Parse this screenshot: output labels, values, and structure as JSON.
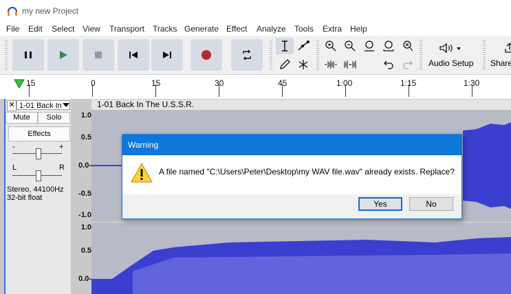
{
  "window": {
    "title": "my new Project"
  },
  "menu": [
    "File",
    "Edit",
    "Select",
    "View",
    "Transport",
    "Tracks",
    "Generate",
    "Effect",
    "Analyze",
    "Tools",
    "Extra",
    "Help"
  ],
  "toolbar": {
    "transport_icons": [
      "pause-icon",
      "play-icon",
      "stop-icon",
      "skip-start-icon",
      "skip-end-icon",
      "record-icon",
      "loop-icon"
    ],
    "audio_setup_label": "Audio Setup",
    "share_label": "Share"
  },
  "ruler": {
    "labels": [
      "15",
      "0",
      "15",
      "30",
      "45",
      "1:00",
      "1:15",
      "1:30"
    ]
  },
  "track": {
    "name": "1-01 Back In",
    "mute_label": "Mute",
    "solo_label": "Solo",
    "effects_label": "Effects",
    "gain_minus": "-",
    "gain_plus": "+",
    "pan_left": "L",
    "pan_right": "R",
    "format_line1": "Stereo, 44100Hz",
    "format_line2": "32-bit float",
    "clip_title": "1-01 Back In The U.S.S.R.",
    "scale_top": [
      "1.0",
      "0.5",
      "0.0-",
      "-0.5",
      "-1.0"
    ],
    "scale_bottom": [
      "1.0",
      "0.5",
      "0.0-"
    ]
  },
  "dialog": {
    "title": "Warning",
    "message": "A file named \"C:\\Users\\Peter\\Desktop\\my WAV file.wav\" already exists. Replace?",
    "yes_label": "Yes",
    "no_label": "No"
  },
  "colors": {
    "accent": "#0d78d7",
    "wave": "#3a3fd0",
    "wave_bg": "#b7bac7",
    "record": "#b02a2a",
    "play": "#2e8b57"
  }
}
